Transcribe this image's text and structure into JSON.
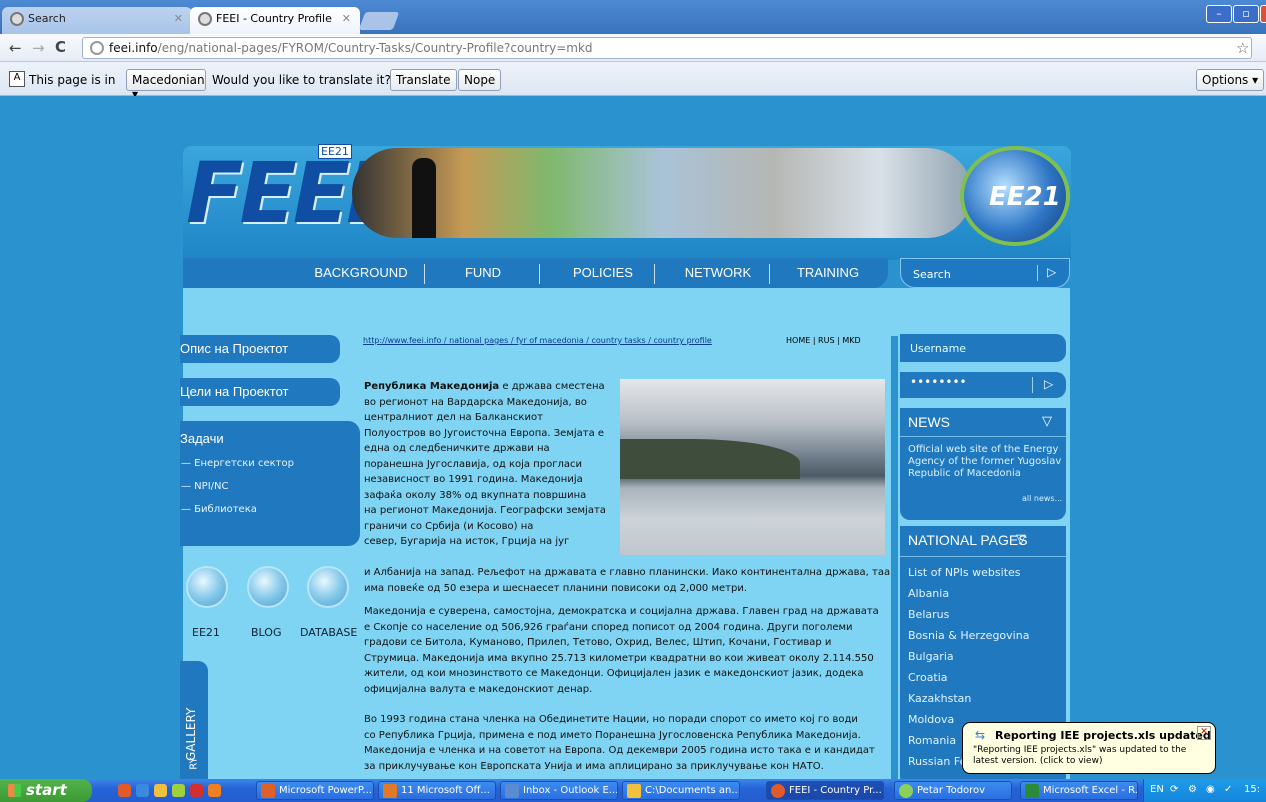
{
  "browser": {
    "tabs": [
      {
        "label": "Search"
      },
      {
        "label": "FEEI - Country Profile"
      }
    ],
    "url": {
      "host": "feei.info",
      "path": "/eng/national-pages/FYROM/Country-Tasks/Country-Profile?country=mkd"
    },
    "translate_bar": {
      "text1": "This page is in",
      "language": "Macedonian ▾",
      "text2": "Would you like to translate it?",
      "translate_btn": "Translate",
      "nope_btn": "Nope",
      "options_btn": "Options ▾"
    }
  },
  "site": {
    "logo": "FEEI",
    "logo_sup": "EE21",
    "globe_label": "EE21",
    "menu": [
      "BACKGROUND",
      "FUND",
      "POLICIES",
      "NETWORK",
      "TRAINING"
    ],
    "search_placeholder": "Search",
    "left_menu": [
      "Опис на Проектот",
      "Цели на Проектот",
      "Задачи"
    ],
    "submenu": [
      "— Енергетски сектор",
      "— NPI/NC",
      "— Библиотека"
    ],
    "bubbles": [
      "EE21",
      "BLOG",
      "DATABASE"
    ],
    "gallery": "GALLERY",
    "gallery2": "RY",
    "breadcrumb": "http://www.feei.info / national pages / fyr of macedonia / country tasks / country profile",
    "langs": "HOME | RUS | MKD",
    "para1_bold": "Република Македонија",
    "para1_lines": [
      "е држава сместена",
      "во регионот на Вардарска Македонија, во",
      "централниот дел на Балканскиот",
      "Полуостров во Југоисточна Европа. Земјата е",
      "една од следбеничките држави на",
      "поранешна Југославија, од која прогласи",
      "независност во 1991 година. Македонија",
      "зафаќа околу 38% од вкупната површина",
      "на регионот Македонија. Географски земјата",
      "граничи со Србија (и Косово) на",
      "север, Бугарија на исток, Грција на југ",
      "и Албанија на запад. Рељефот на државата е главно планински. Иако континентална држава, таа",
      "има повеќе од 50 езера и шеснаесет планини повисоки од 2,000 метри."
    ],
    "para2_lines": [
      "Македонија е суверена, самостојна, демократска и социјална држава. Главен град на државата",
      "е Скопје со население од 506,926 граѓани според пописот од 2004 година. Други поголеми",
      "градови се Битола, Куманово, Прилеп, Тетово, Охрид, Велес, Штип, Кочани, Гостивар и",
      "Струмица. Македонија има вкупно 25.713 километри квадратни во кои живеат околу 2.114.550",
      "жители, од кои мнозинството се Македонци. Официјален јазик е македонскиот јазик, додека",
      "официјална валута е македонскиот денар."
    ],
    "para3_lines": [
      "Во 1993 година стана членка на Обединетите Нации, но поради спорот со името кој го води",
      "со Република Грција, примена е под името Поранешна Југословенска Република Македонија.",
      "Македонија е членка и на советот на Европа. Од декември 2005 година исто така е и кандидат",
      "за приклучување кон Европската Унија и има аплицирано за приклучување кон НАТО."
    ],
    "username": "Username",
    "password": "••••••••",
    "news_title": "NEWS",
    "news_text": "Official web site of the Energy Agency of the former Yugoslav Republic of Macedonia",
    "all_news": "all news...",
    "national_title": "NATIONAL PAGES",
    "national_items": [
      "List of NPIs websites",
      "Albania",
      "Belarus",
      "Bosnia & Herzegovina",
      "Bulgaria",
      "Croatia",
      "Kazakhstan",
      "Moldova",
      "Romania",
      "Russian Fe"
    ]
  },
  "notification": {
    "title": "Reporting IEE projects.xls updated",
    "body": "\"Reporting IEE projects.xls\" was updated to the latest version. (click to view)"
  },
  "taskbar": {
    "start": "start",
    "tasks": [
      "Microsoft PowerP...",
      "11 Microsoft Off...",
      "Inbox - Outlook E...",
      "C:\\Documents an...",
      "FEEI - Country Pr...",
      "Petar Todorov",
      "Microsoft Excel - R..."
    ],
    "lang": "EN",
    "clock": "15:"
  }
}
